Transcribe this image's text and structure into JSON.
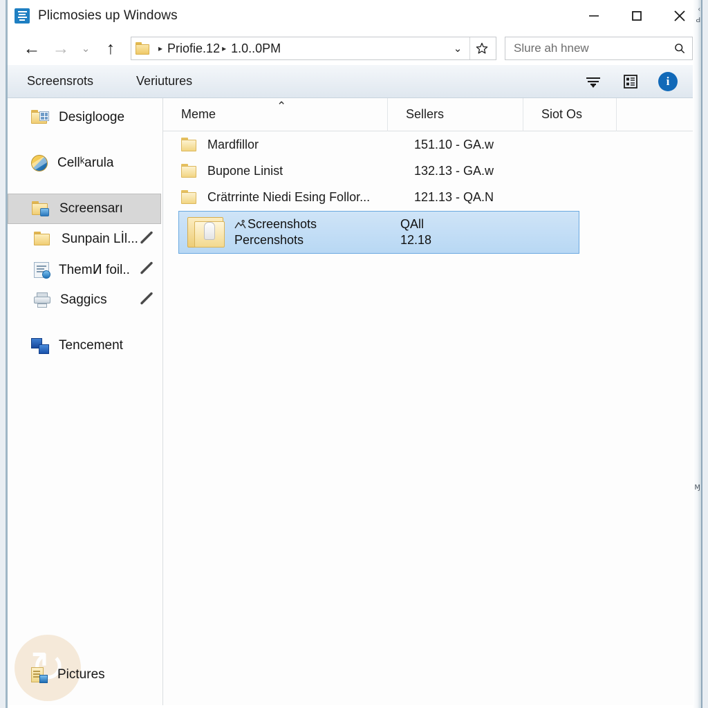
{
  "window": {
    "title": "Plicmosies up Windows",
    "app_icon": "document-lines-icon",
    "controls": {
      "minimize": "minimize-icon",
      "maximize": "maximize-icon",
      "close": "close-icon"
    }
  },
  "addressbar": {
    "back": "←",
    "forward": "→",
    "history": "⌄",
    "up": "↑",
    "folder_icon": "folder-icon",
    "crumbs": [
      "Priofie.12",
      "1.0..0PM"
    ],
    "separator": "▸",
    "dropdown": "⌄",
    "favorite": "star-icon"
  },
  "search": {
    "value": "Slure ah hnew",
    "placeholder": "Slure ah hnew",
    "icon": "search-icon"
  },
  "ribbon": {
    "tabs": [
      "Screensrots",
      "Veriutures"
    ],
    "tools": [
      "sort-icon",
      "details-view-icon",
      "info-icon"
    ],
    "info_label": "i"
  },
  "sidebar": {
    "items": [
      {
        "label": "Desiglooge",
        "icon": "folder-grid-icon",
        "pin": false,
        "selected": false
      },
      {
        "label": "Cellᵏarula",
        "icon": "sphere-icon",
        "pin": false,
        "selected": false
      },
      {
        "label": "Screensarı",
        "icon": "folder-blue-icon",
        "pin": false,
        "selected": true
      },
      {
        "label": "Sunpain Lİl...",
        "icon": "folder-flag-icon",
        "pin": true,
        "selected": false
      },
      {
        "label": "ThemͶ foil..",
        "icon": "document-shield-icon",
        "pin": true,
        "selected": false
      },
      {
        "label": "Saggics",
        "icon": "printer-icon",
        "pin": true,
        "selected": false
      },
      {
        "label": "Tencement",
        "icon": "monitor-icon",
        "pin": false,
        "selected": false
      }
    ],
    "bottom_item": {
      "label": "Pictures",
      "icon": "pictures-icon"
    },
    "watermark": "refresh-watermark-icon"
  },
  "filelist": {
    "columns": [
      "Meme",
      "Sellers",
      "Siot Os"
    ],
    "sort_caret": "⌃",
    "rows": [
      {
        "name": "Mardfillor",
        "sellers": "151.10 - GA.w",
        "icon": "folder-icon"
      },
      {
        "name": "Bupone Linist",
        "sellers": "132.13 - GA.w",
        "icon": "folder-icon"
      },
      {
        "name": "Crätrrinte Niedi Esing Follor...",
        "sellers": "121.13 - QA.N",
        "icon": "folder-icon"
      }
    ],
    "selected": {
      "icon": "open-folder-icon",
      "line1_name": "Screenshots",
      "line1_value": "QAll",
      "line1_glyph": "picture-icon",
      "line2_name": "Percenshots",
      "line2_value": "12.18"
    }
  },
  "colors": {
    "accent": "#1169b8",
    "selection_fill": "#c4dcf4",
    "selection_border": "#6aa8e0",
    "ribbon_bg": "#e6edf4",
    "sidebar_selected": "#d7d7d7",
    "folder_yellow": "#f0cd73"
  },
  "edge": {
    "mark_top": "‹",
    "mark_mid": "Ԁ",
    "mark_low": "Ɱ"
  }
}
